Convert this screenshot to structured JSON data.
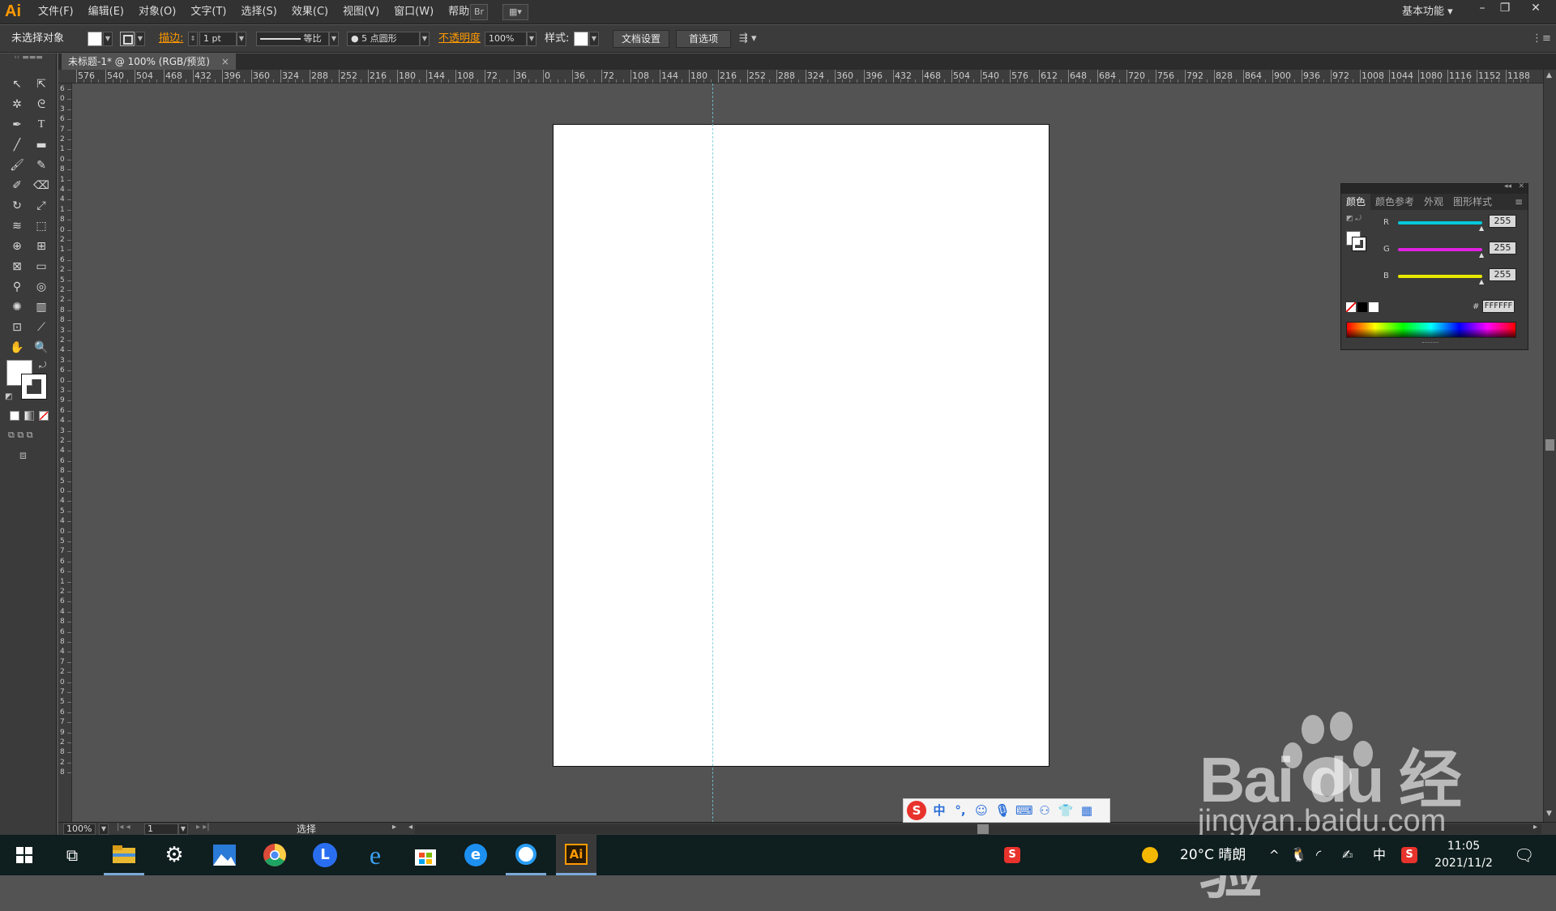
{
  "app": {
    "logo": "Ai",
    "menus": [
      "文件(F)",
      "编辑(E)",
      "对象(O)",
      "文字(T)",
      "选择(S)",
      "效果(C)",
      "视图(V)",
      "窗口(W)",
      "帮助(H)"
    ],
    "workspace": "基本功能 ▾"
  },
  "control": {
    "selection": "未选择对象",
    "stroke_label": "描边:",
    "stroke_value": "1 pt",
    "profile_label": "等比",
    "brush_label": "5 点圆形",
    "opacity_label": "不透明度",
    "opacity_value": "100%",
    "style_label": "样式:",
    "doc_setup": "文档设置",
    "preferences": "首选项"
  },
  "document": {
    "tab_title": "未标题-1* @ 100% (RGB/预览)",
    "close": "×"
  },
  "rulers": {
    "top_ticks": [
      "576",
      "540",
      "504",
      "468",
      "432",
      "396",
      "360",
      "324",
      "288",
      "252",
      "216",
      "180",
      "144",
      "108",
      "72",
      "36",
      "0",
      "36",
      "72",
      "108",
      "144",
      "180",
      "216",
      "252",
      "288",
      "324",
      "360",
      "396",
      "432",
      "468",
      "504",
      "540",
      "576",
      "612",
      "648",
      "684",
      "720",
      "756",
      "792",
      "828",
      "864",
      "900",
      "936",
      "972",
      "1008",
      "1044",
      "1080",
      "1116",
      "1152",
      "1188"
    ],
    "left_ticks": [
      "6",
      "0",
      "3",
      "6",
      "7",
      "2",
      "1",
      "0",
      "8",
      "1",
      "4",
      "4",
      "1",
      "8",
      "0",
      "2",
      "1",
      "6",
      "2",
      "5",
      "2",
      "2",
      "8",
      "8",
      "3",
      "2",
      "4",
      "3",
      "6",
      "0",
      "3",
      "9",
      "6",
      "4",
      "3",
      "2",
      "4",
      "6",
      "8",
      "5",
      "0",
      "4",
      "5",
      "4",
      "0",
      "5",
      "7",
      "6",
      "6",
      "1",
      "2",
      "6",
      "4",
      "8",
      "6",
      "8",
      "4",
      "7",
      "2",
      "0",
      "7",
      "5",
      "6",
      "7",
      "9",
      "2",
      "8",
      "2",
      "8"
    ]
  },
  "status": {
    "zoom": "100%",
    "page": "1",
    "mode": "选择"
  },
  "color_panel": {
    "tabs": [
      "颜色",
      "颜色参考",
      "外观",
      "图形样式"
    ],
    "channels": [
      {
        "label": "R",
        "value": "255",
        "color": "#00c8d8"
      },
      {
        "label": "G",
        "value": "255",
        "color": "#e020e0"
      },
      {
        "label": "B",
        "value": "255",
        "color": "#e8e800"
      }
    ],
    "hex_label": "#",
    "hex_value": "FFFFFF"
  },
  "ime": {
    "logo": "S",
    "mode": "中",
    "punct": "°,"
  },
  "taskbar": {
    "weather": "20°C 晴朗",
    "lang": "中",
    "time": "11:05",
    "date": "2021/11/2",
    "ai_label": "Ai"
  },
  "watermark": {
    "brand": "Bai du 经验",
    "url": "jingyan.baidu.com"
  }
}
